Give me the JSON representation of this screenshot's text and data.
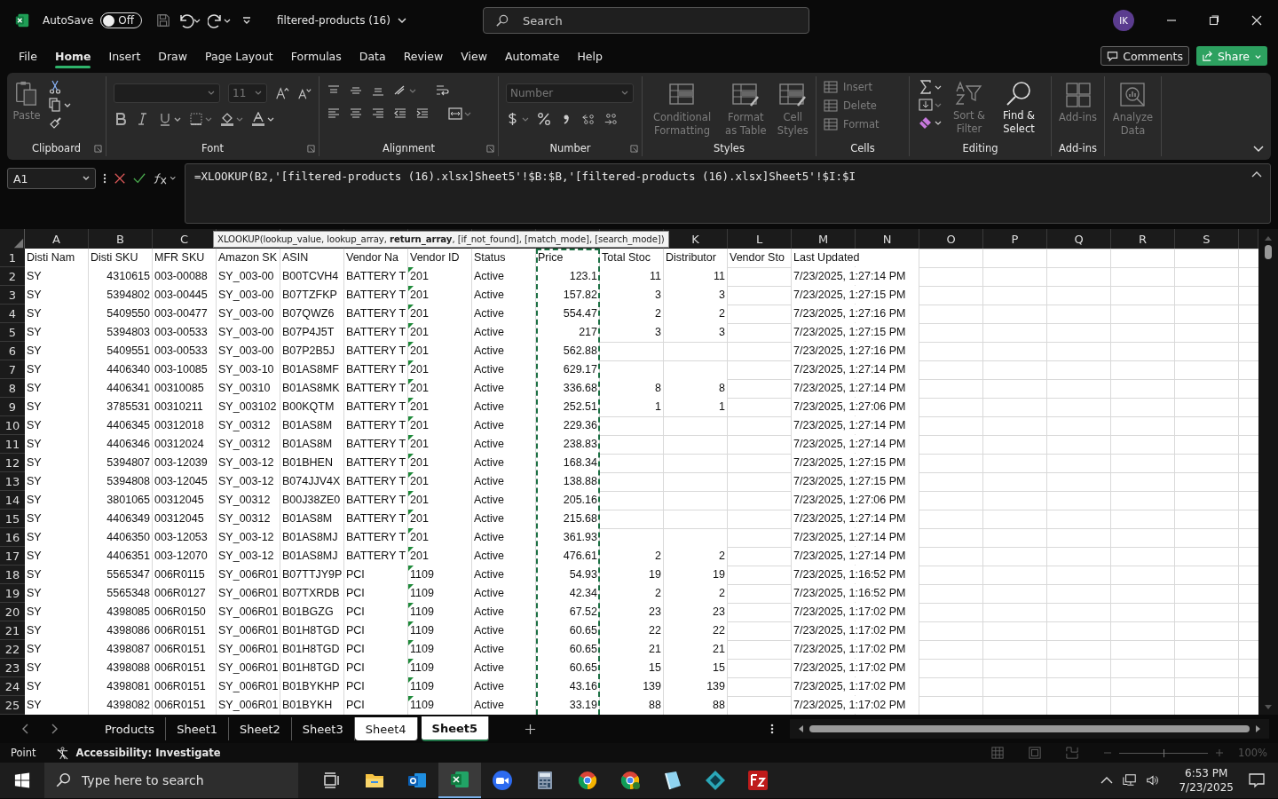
{
  "title_bar": {
    "autosave": {
      "label": "AutoSave",
      "toggle_text": "Off",
      "on": false
    },
    "file_title": "filtered-products (16)",
    "search": {
      "placeholder": "Search"
    },
    "avatar": "IK"
  },
  "menu": {
    "tabs": [
      {
        "label": "File",
        "selected": false
      },
      {
        "label": "Home",
        "selected": true
      },
      {
        "label": "Insert",
        "selected": false
      },
      {
        "label": "Draw",
        "selected": false
      },
      {
        "label": "Page Layout",
        "selected": false
      },
      {
        "label": "Formulas",
        "selected": false
      },
      {
        "label": "Data",
        "selected": false
      },
      {
        "label": "Review",
        "selected": false
      },
      {
        "label": "View",
        "selected": false
      },
      {
        "label": "Automate",
        "selected": false
      },
      {
        "label": "Help",
        "selected": false
      }
    ],
    "comments": "Comments",
    "share": "Share"
  },
  "ribbon": {
    "clipboard": {
      "label": "Clipboard",
      "paste": {
        "label": "Paste",
        "disabled": true
      }
    },
    "font": {
      "label": "Font",
      "font_size": "11"
    },
    "alignment": {
      "label": "Alignment"
    },
    "number": {
      "label": "Number",
      "format": "Number"
    },
    "styles": {
      "label": "Styles",
      "buttons": [
        {
          "label": "Conditional Formatting",
          "disabled": true
        },
        {
          "label": "Format as Table",
          "disabled": true
        },
        {
          "label": "Cell Styles",
          "disabled": true
        }
      ]
    },
    "cells": {
      "label": "Cells",
      "buttons": [
        {
          "label": "Insert",
          "disabled": true
        },
        {
          "label": "Delete",
          "disabled": true
        },
        {
          "label": "Format",
          "disabled": true
        }
      ]
    },
    "editing": {
      "label": "Editing",
      "buttons": [
        {
          "label": "Sort & Filter",
          "disabled": true
        },
        {
          "label": "Find & Select",
          "disabled": false
        }
      ]
    },
    "addins": {
      "label": "Add-ins",
      "buttons": [
        {
          "label": "Add-ins",
          "disabled": true
        },
        {
          "label": "Analyze Data",
          "disabled": true
        }
      ]
    }
  },
  "formula_bar": {
    "name_box": "A1",
    "formula": "=XLOOKUP(B2,'[filtered-products (16).xlsx]Sheet5'!$B:$B,'[filtered-products (16).xlsx]Sheet5'!$I:$I",
    "tooltip": "XLOOKUP(lookup_value, lookup_array, **return_array**, [if_not_found], [match_mode], [search_mode])"
  },
  "sheet": {
    "columns": [
      {
        "letter": "A",
        "numeric": false
      },
      {
        "letter": "B",
        "numeric": true
      },
      {
        "letter": "C",
        "numeric": false
      },
      {
        "numeric": false
      },
      {
        "numeric": false
      },
      {
        "numeric": false
      },
      {
        "numeric": false
      },
      {
        "numeric": false
      },
      {
        "numeric": true,
        "referenced": true
      },
      {
        "numeric": true
      },
      {
        "letter": "K",
        "numeric": true
      },
      {
        "letter": "L"
      },
      {
        "letter": "M",
        "numeric": false
      },
      {
        "letter": "N"
      },
      {
        "letter": "O"
      },
      {
        "letter": "P"
      },
      {
        "letter": "Q"
      },
      {
        "letter": "R"
      },
      {
        "letter": "S"
      }
    ],
    "rows": [
      {
        "number": "1",
        "kind": "header",
        "flagged": false,
        "cells": {
          "A": "Disti Nam",
          "B": "Disti SKU",
          "C": "MFR SKU",
          "D": "Amazon SK",
          "E": "ASIN",
          "F": "Vendor Na",
          "G": "Vendor ID",
          "H": "Status",
          "I": "Price",
          "J": "Total Stoc",
          "K": "Distributor",
          "L": "Vendor Sto",
          "M": "Last Updated"
        }
      },
      {
        "number": "2",
        "kind": "data",
        "flagged": true,
        "cells": {
          "A": "SY",
          "B": "4310615",
          "C": "003-00088",
          "D": "SY_003-00",
          "E": "B00TCVH4",
          "F": "BATTERY T",
          "G": "201",
          "H": "Active",
          "I": "123.1",
          "J": "11",
          "K": "11",
          "M": "7/23/2025, 1:27:14 PM"
        }
      },
      {
        "number": "3",
        "kind": "data",
        "flagged": true,
        "cells": {
          "A": "SY",
          "B": "5394802",
          "C": "003-00445",
          "D": "SY_003-00",
          "E": "B07TZFKP",
          "F": "BATTERY T",
          "G": "201",
          "H": "Active",
          "I": "157.82",
          "J": "3",
          "K": "3",
          "M": "7/23/2025, 1:27:15 PM"
        }
      },
      {
        "number": "4",
        "kind": "data",
        "flagged": true,
        "cells": {
          "A": "SY",
          "B": "5409550",
          "C": "003-00477",
          "D": "SY_003-00",
          "E": "B07QWZ6",
          "F": "BATTERY T",
          "G": "201",
          "H": "Active",
          "I": "554.47",
          "J": "2",
          "K": "2",
          "M": "7/23/2025, 1:27:16 PM"
        }
      },
      {
        "number": "5",
        "kind": "data",
        "flagged": true,
        "cells": {
          "A": "SY",
          "B": "5394803",
          "C": "003-00533",
          "D": "SY_003-00",
          "E": "B07P4J5T",
          "F": "BATTERY T",
          "G": "201",
          "H": "Active",
          "I": "217",
          "J": "3",
          "K": "3",
          "M": "7/23/2025, 1:27:15 PM"
        }
      },
      {
        "number": "6",
        "kind": "data",
        "flagged": true,
        "cells": {
          "A": "SY",
          "B": "5409551",
          "C": "003-00533",
          "D": "SY_003-00",
          "E": "B07P2B5J",
          "F": "BATTERY T",
          "G": "201",
          "H": "Active",
          "I": "562.88",
          "M": "7/23/2025, 1:27:16 PM"
        }
      },
      {
        "number": "7",
        "kind": "data",
        "flagged": true,
        "cells": {
          "A": "SY",
          "B": "4406340",
          "C": "003-10085",
          "D": "SY_003-10",
          "E": "B01AS8MF",
          "F": "BATTERY T",
          "G": "201",
          "H": "Active",
          "I": "629.17",
          "M": "7/23/2025, 1:27:14 PM"
        }
      },
      {
        "number": "8",
        "kind": "data",
        "flagged": true,
        "cells": {
          "A": "SY",
          "B": "4406341",
          "C": "00310085",
          "D": "SY_00310",
          "E": "B01AS8MK",
          "F": "BATTERY T",
          "G": "201",
          "H": "Active",
          "I": "336.68",
          "J": "8",
          "K": "8",
          "M": "7/23/2025, 1:27:14 PM"
        }
      },
      {
        "number": "9",
        "kind": "data",
        "flagged": true,
        "cells": {
          "A": "SY",
          "B": "3785531",
          "C": "00310211",
          "D": "SY_003102",
          "E": "B00KQTM",
          "F": "BATTERY T",
          "G": "201",
          "H": "Active",
          "I": "252.51",
          "J": "1",
          "K": "1",
          "M": "7/23/2025, 1:27:06 PM"
        }
      },
      {
        "number": "10",
        "kind": "data",
        "flagged": true,
        "cells": {
          "A": "SY",
          "B": "4406345",
          "C": "00312018",
          "D": "SY_00312",
          "E": "B01AS8M",
          "F": "BATTERY T",
          "G": "201",
          "H": "Active",
          "I": "229.36",
          "M": "7/23/2025, 1:27:14 PM"
        }
      },
      {
        "number": "11",
        "kind": "data",
        "flagged": true,
        "cells": {
          "A": "SY",
          "B": "4406346",
          "C": "00312024",
          "D": "SY_00312",
          "E": "B01AS8M",
          "F": "BATTERY T",
          "G": "201",
          "H": "Active",
          "I": "238.83",
          "M": "7/23/2025, 1:27:14 PM"
        }
      },
      {
        "number": "12",
        "kind": "data",
        "flagged": true,
        "cells": {
          "A": "SY",
          "B": "5394807",
          "C": "003-12039",
          "D": "SY_003-12",
          "E": "B01BHEN",
          "F": "BATTERY T",
          "G": "201",
          "H": "Active",
          "I": "168.34",
          "M": "7/23/2025, 1:27:15 PM"
        }
      },
      {
        "number": "13",
        "kind": "data",
        "flagged": true,
        "cells": {
          "A": "SY",
          "B": "5394808",
          "C": "003-12045",
          "D": "SY_003-12",
          "E": "B074JJV4X",
          "F": "BATTERY T",
          "G": "201",
          "H": "Active",
          "I": "138.88",
          "M": "7/23/2025, 1:27:15 PM"
        }
      },
      {
        "number": "14",
        "kind": "data",
        "flagged": true,
        "cells": {
          "A": "SY",
          "B": "3801065",
          "C": "00312045",
          "D": "SY_00312",
          "E": "B00J38ZE0",
          "F": "BATTERY T",
          "G": "201",
          "H": "Active",
          "I": "205.16",
          "M": "7/23/2025, 1:27:06 PM"
        }
      },
      {
        "number": "15",
        "kind": "data",
        "flagged": true,
        "cells": {
          "A": "SY",
          "B": "4406349",
          "C": "00312045",
          "D": "SY_00312",
          "E": "B01AS8M",
          "F": "BATTERY T",
          "G": "201",
          "H": "Active",
          "I": "215.68",
          "M": "7/23/2025, 1:27:14 PM"
        }
      },
      {
        "number": "16",
        "kind": "data",
        "flagged": true,
        "cells": {
          "A": "SY",
          "B": "4406350",
          "C": "003-12053",
          "D": "SY_003-12",
          "E": "B01AS8MJ",
          "F": "BATTERY T",
          "G": "201",
          "H": "Active",
          "I": "361.93",
          "M": "7/23/2025, 1:27:14 PM"
        }
      },
      {
        "number": "17",
        "kind": "data",
        "flagged": true,
        "cells": {
          "A": "SY",
          "B": "4406351",
          "C": "003-12070",
          "D": "SY_003-12",
          "E": "B01AS8MJ",
          "F": "BATTERY T",
          "G": "201",
          "H": "Active",
          "I": "476.61",
          "J": "2",
          "K": "2",
          "M": "7/23/2025, 1:27:14 PM"
        }
      },
      {
        "number": "18",
        "kind": "data",
        "flagged": true,
        "cells": {
          "A": "SY",
          "B": "5565347",
          "C": "006R0115",
          "D": "SY_006R01",
          "E": "B07TTJY9P",
          "F": "PCI",
          "G": "1109",
          "H": "Active",
          "I": "54.93",
          "J": "19",
          "K": "19",
          "M": "7/23/2025, 1:16:52 PM"
        }
      },
      {
        "number": "19",
        "kind": "data",
        "flagged": true,
        "cells": {
          "A": "SY",
          "B": "5565348",
          "C": "006R0127",
          "D": "SY_006R01",
          "E": "B07TXRDB",
          "F": "PCI",
          "G": "1109",
          "H": "Active",
          "I": "42.34",
          "J": "2",
          "K": "2",
          "M": "7/23/2025, 1:16:52 PM"
        }
      },
      {
        "number": "20",
        "kind": "data",
        "flagged": true,
        "cells": {
          "A": "SY",
          "B": "4398085",
          "C": "006R0150",
          "D": "SY_006R01",
          "E": "B01BGZG",
          "F": "PCI",
          "G": "1109",
          "H": "Active",
          "I": "67.52",
          "J": "23",
          "K": "23",
          "M": "7/23/2025, 1:17:02 PM"
        }
      },
      {
        "number": "21",
        "kind": "data",
        "flagged": true,
        "cells": {
          "A": "SY",
          "B": "4398086",
          "C": "006R0151",
          "D": "SY_006R01",
          "E": "B01H8TGD",
          "F": "PCI",
          "G": "1109",
          "H": "Active",
          "I": "60.65",
          "J": "22",
          "K": "22",
          "M": "7/23/2025, 1:17:02 PM"
        }
      },
      {
        "number": "22",
        "kind": "data",
        "flagged": true,
        "cells": {
          "A": "SY",
          "B": "4398087",
          "C": "006R0151",
          "D": "SY_006R01",
          "E": "B01H8TGD",
          "F": "PCI",
          "G": "1109",
          "H": "Active",
          "I": "60.65",
          "J": "21",
          "K": "21",
          "M": "7/23/2025, 1:17:02 PM"
        }
      },
      {
        "number": "23",
        "kind": "data",
        "flagged": true,
        "cells": {
          "A": "SY",
          "B": "4398088",
          "C": "006R0151",
          "D": "SY_006R01",
          "E": "B01H8TGD",
          "F": "PCI",
          "G": "1109",
          "H": "Active",
          "I": "60.65",
          "J": "15",
          "K": "15",
          "M": "7/23/2025, 1:17:02 PM"
        }
      },
      {
        "number": "24",
        "kind": "data",
        "flagged": true,
        "cells": {
          "A": "SY",
          "B": "4398081",
          "C": "006R0151",
          "D": "SY_006R01",
          "E": "B01BYKHP",
          "F": "PCI",
          "G": "1109",
          "H": "Active",
          "I": "43.16",
          "J": "139",
          "K": "139",
          "M": "7/23/2025, 1:17:02 PM"
        }
      },
      {
        "number": "25",
        "kind": "data",
        "flagged": true,
        "cells": {
          "A": "SY",
          "B": "4398082",
          "C": "006R0151",
          "D": "SY_006R01",
          "E": "B01BYKH",
          "F": "PCI",
          "G": "1109",
          "H": "Active",
          "I": "33.19",
          "J": "88",
          "K": "88",
          "M": "7/23/2025, 1:17:02 PM"
        }
      }
    ]
  },
  "sheet_tabs": [
    {
      "label": "Products",
      "selected": false,
      "active": false
    },
    {
      "label": "Sheet1",
      "selected": false,
      "active": false
    },
    {
      "label": "Sheet2",
      "selected": false,
      "active": false
    },
    {
      "label": "Sheet3",
      "selected": false,
      "active": false
    },
    {
      "label": "Sheet4",
      "selected": true,
      "active": false
    },
    {
      "label": "Sheet5",
      "selected": true,
      "active": true
    }
  ],
  "status_bar": {
    "mode": "Point",
    "accessibility": "Accessibility: Investigate",
    "zoom": {
      "level": 0.5,
      "reading": "100%"
    }
  },
  "taskbar": {
    "search_placeholder": "Type here to search",
    "time": "6:53 PM",
    "date": "7/23/2025"
  }
}
